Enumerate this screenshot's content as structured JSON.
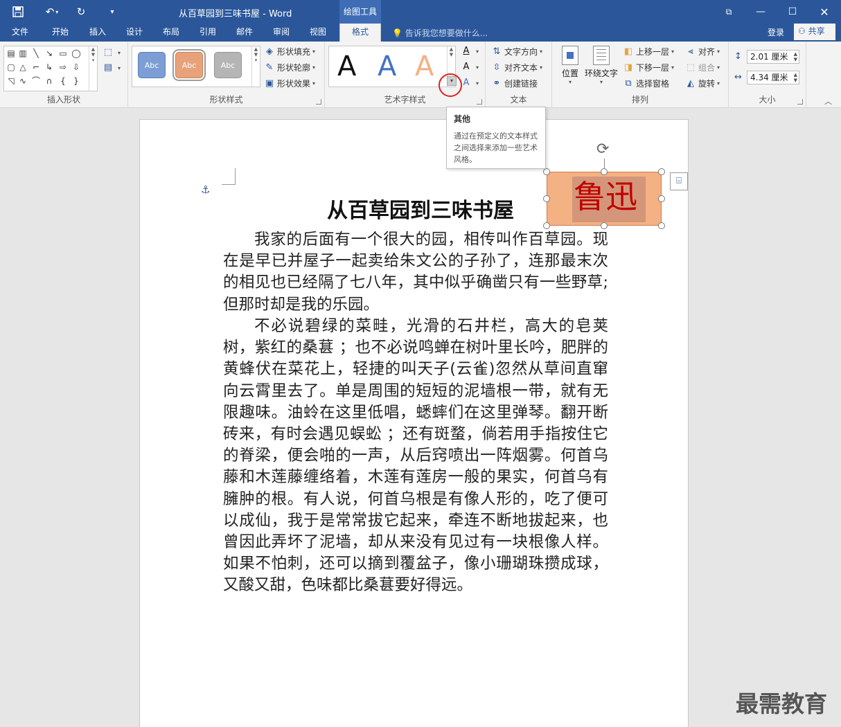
{
  "quick_access": {
    "save_icon": "save-icon",
    "undo_icon": "undo-icon",
    "redo_icon": "redo-icon",
    "customize_icon": "customize-icon"
  },
  "window": {
    "title": "从百草园到三味书屋 - Word",
    "context_label": "绘图工具"
  },
  "tabs": [
    "文件",
    "开始",
    "插入",
    "设计",
    "布局",
    "引用",
    "邮件",
    "审阅",
    "视图",
    "格式"
  ],
  "active_tab": "格式",
  "tell_me": "告诉我您想要做什么...",
  "account": {
    "signin": "登录",
    "share": "共享"
  },
  "ribbon": {
    "insert_shapes": {
      "label": "插入形状"
    },
    "shape_styles": {
      "label": "形状样式",
      "sample_text": "Abc",
      "fill": "形状填充",
      "outline": "形状轮廓",
      "effects": "形状效果"
    },
    "wordart_styles": {
      "label": "艺术字样式",
      "sample": "A"
    },
    "text": {
      "label": "文本",
      "direction": "文字方向",
      "align": "对齐文本",
      "link": "创建链接"
    },
    "arrange": {
      "label": "排列",
      "position": "位置",
      "wrap": "环绕文字",
      "bring_forward": "上移一层",
      "send_backward": "下移一层",
      "selection_pane": "选择窗格",
      "align": "对齐",
      "group": "组合",
      "rotate": "旋转"
    },
    "size": {
      "label": "大小",
      "height": "2.01 厘米",
      "width": "4.34 厘米"
    }
  },
  "tooltip": {
    "title": "其他",
    "body": "通过在预定义的文本样式之间选择来添加一些艺术风格。"
  },
  "document": {
    "heading": "从百草园到三味书屋",
    "wordart_text": "鲁迅",
    "paragraphs": [
      "我家的后面有一个很大的园，相传叫作百草园。现在是早已并屋子一起卖给朱文公的子孙了，连那最末次的相见也已经隔了七八年，其中似乎确凿只有一些野草;但那时却是我的乐园。",
      "不必说碧绿的菜畦，光滑的石井栏，高大的皂荚树，紫红的桑葚 ；也不必说鸣蝉在树叶里长吟，肥胖的黄蜂伏在菜花上，轻捷的叫天子(云雀)忽然从草间直窜向云霄里去了。单是周围的短短的泥墙根一带，就有无限趣味。油蛉在这里低唱，蟋蟀们在这里弹琴。翻开断砖来，有时会遇见蜈蚣 ；还有斑蝥，倘若用手指按住它的脊梁，便会啪的一声，从后窍喷出一阵烟雾。何首乌藤和木莲藤缠络着，木莲有莲房一般的果实，何首乌有臃肿的根。有人说，何首乌根是有像人形的，吃了便可以成仙，我于是常常拔它起来，牵连不断地拔起来，也曾因此弄坏了泥墙，却从来没有见过有一块根像人样。如果不怕刺，还可以摘到覆盆子，像小珊瑚珠攒成球，又酸又甜，色味都比桑葚要好得远。"
    ]
  },
  "watermark": "最需教育",
  "colors": {
    "brand": "#2b579a",
    "shape_fill": "#f4b183",
    "wordart_red": "#c00000",
    "highlight_circle": "#e02020"
  }
}
